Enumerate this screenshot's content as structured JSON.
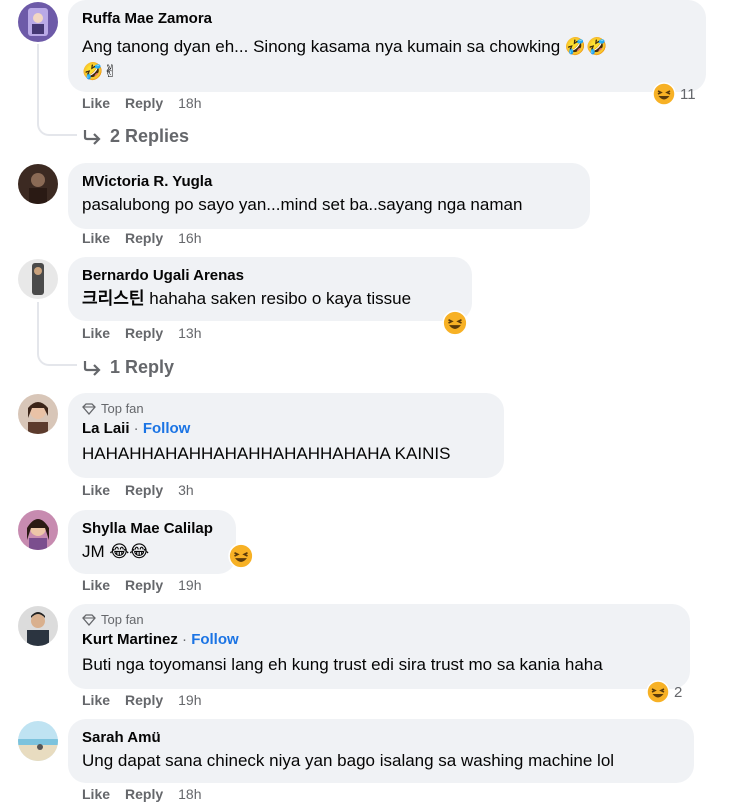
{
  "actions": {
    "like": "Like",
    "reply": "Reply"
  },
  "top_fan_label": "Top fan",
  "follow_label": "Follow",
  "comments": [
    {
      "name": "Ruffa Mae Zamora",
      "text_line1": "Ang tanong dyan eh... Sinong kasama nya kumain sa chowking 🤣🤣",
      "text_line2": "🤣✌",
      "time": "18h",
      "reaction_count": "11",
      "replies": "2 Replies"
    },
    {
      "name": "MVictoria R. Yugla",
      "text": "pasalubong po sayo yan...mind set ba..sayang nga naman",
      "time": "16h"
    },
    {
      "name": "Bernardo Ugali Arenas",
      "mention": "크리스틴",
      "text": "hahaha saken resibo o kaya tissue",
      "time": "13h",
      "replies": "1 Reply"
    },
    {
      "name": "La Laii",
      "text": "HAHAHHAHAHHAHAHHAHAHHAHAHA KAINIS",
      "time": "3h",
      "top_fan": true
    },
    {
      "name": "Shylla Mae Calilap",
      "text": "JM 😂😂",
      "time": "19h"
    },
    {
      "name": "Kurt Martinez",
      "text": "Buti nga toyomansi lang eh kung trust edi sira trust mo sa kania haha",
      "time": "19h",
      "top_fan": true,
      "reaction_count": "2"
    },
    {
      "name": "Sarah Amü",
      "text": "Ung dapat sana chineck niya yan bago isalang sa washing machine lol",
      "time": "18h"
    }
  ],
  "colors": {
    "bubble": "#f0f2f5",
    "meta": "#65676b",
    "link": "#1b74e4",
    "thread": "#e4e6eb"
  }
}
